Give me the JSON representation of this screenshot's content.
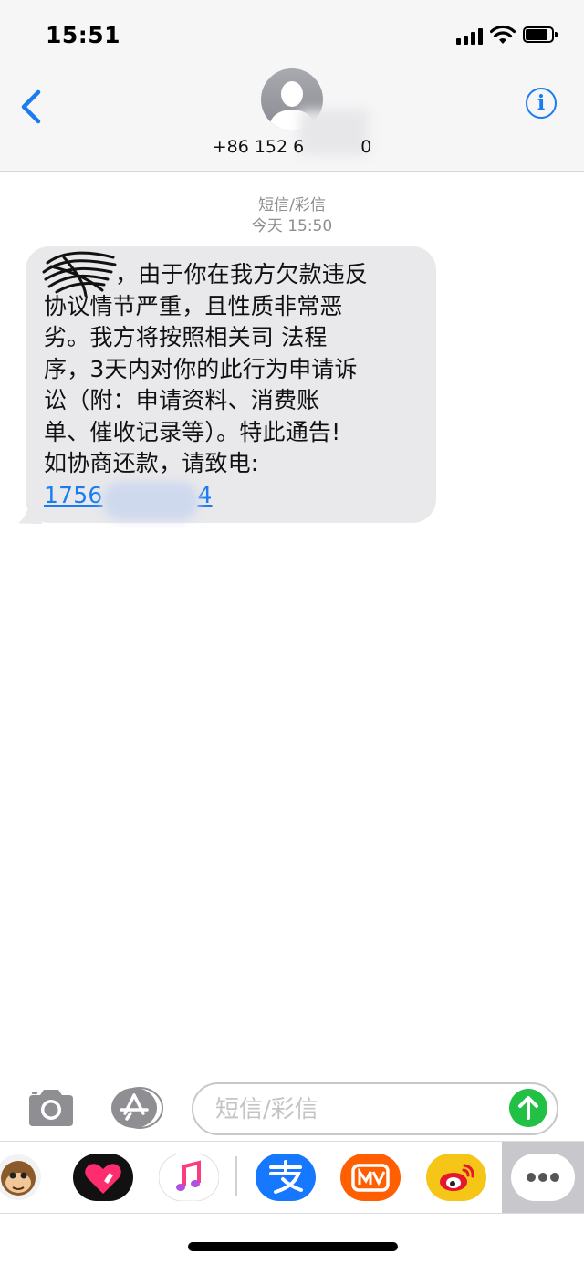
{
  "status_bar": {
    "time": "15:51"
  },
  "header": {
    "contact_number": "+86 152 6",
    "contact_number_suffix": "0",
    "back_label": "back",
    "info_label": "i"
  },
  "conversation": {
    "message_type": "短信/彩信",
    "timestamp": "今天 15:50",
    "message": {
      "lines": [
        "，由于你在我方欠款违反",
        "协议情节严重，且性质非常恶",
        "劣。我方将按照相关司 法程",
        "序，3天内对你的此行为申请诉",
        "讼（附：申请资料、消费账",
        "单、催收记录等）。特此通告!",
        "如协商还款，请致电:"
      ],
      "phone_prefix": "1756",
      "phone_suffix": "4"
    }
  },
  "input_bar": {
    "placeholder": "短信/彩信"
  },
  "app_drawer": {
    "apps": [
      "animoji-icon",
      "digital-touch-icon",
      "music-icon",
      "alipay-icon",
      "mango-tv-icon",
      "weibo-icon",
      "more-apps-icon"
    ],
    "colors": {
      "digital_touch": "#111111",
      "alipay": "#1677ff",
      "mango": "#ff5f00",
      "weibo": "#f5c518",
      "more_bg": "#c8c8cc"
    }
  },
  "colors": {
    "accent": "#1b7cf2",
    "bubble": "#e9e9eb",
    "send": "#22c045"
  }
}
